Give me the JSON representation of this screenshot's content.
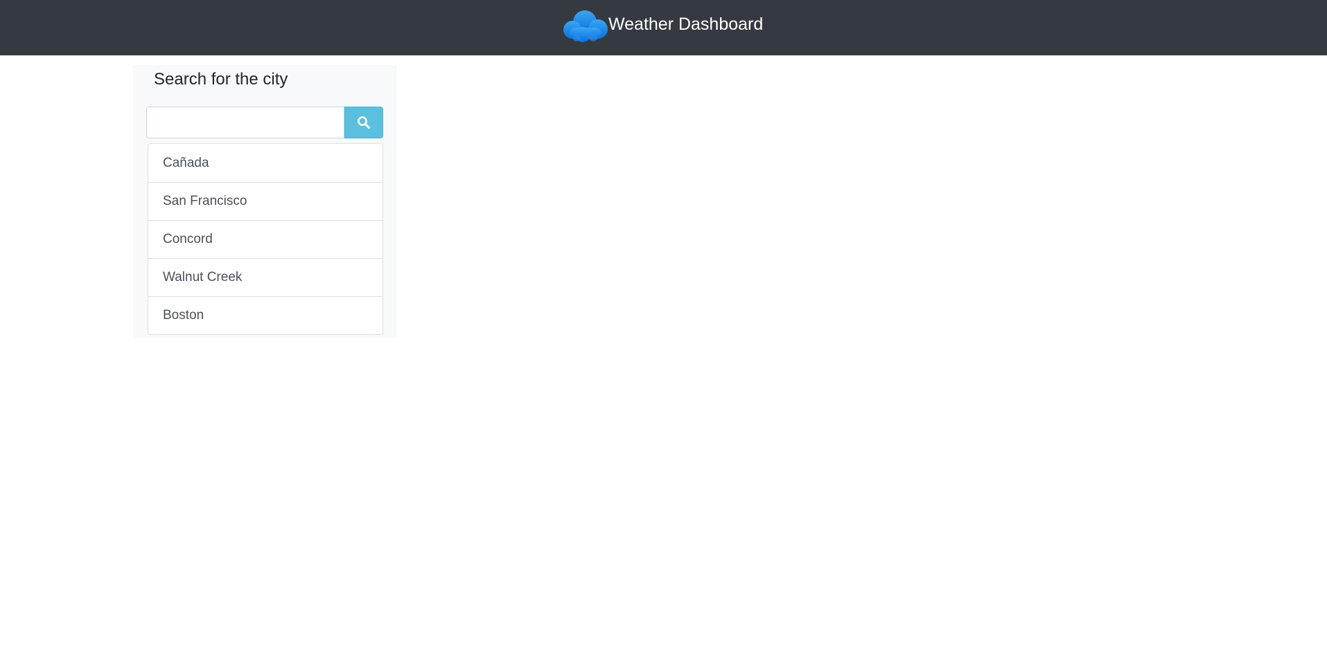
{
  "header": {
    "title": "Weather Dashboard",
    "logo_icon": "cloud-icon",
    "background": "#343a40"
  },
  "search": {
    "heading": "Search for the city",
    "input_value": "",
    "input_placeholder": "",
    "button_icon": "search-icon",
    "button_color": "#5bc0de"
  },
  "cities": [
    {
      "name": "Cañada"
    },
    {
      "name": "San Francisco"
    },
    {
      "name": "Concord"
    },
    {
      "name": "Walnut Creek"
    },
    {
      "name": "Boston"
    }
  ]
}
